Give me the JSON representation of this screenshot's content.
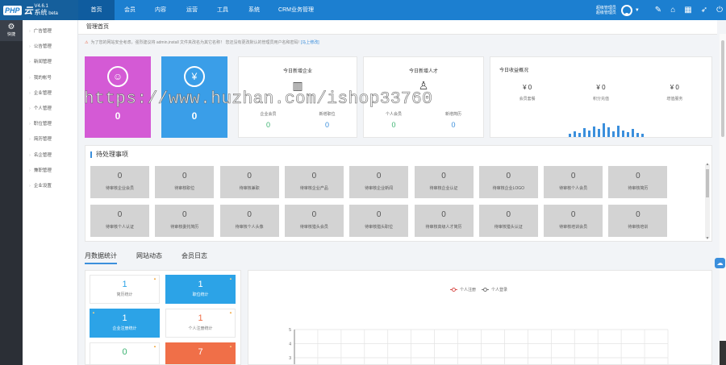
{
  "app": {
    "logo_badge": "PHP",
    "logo_name": "云",
    "version": "V4.6.1",
    "system": "系统",
    "edition": "beta"
  },
  "nav": [
    {
      "label": "首页",
      "active": true
    },
    {
      "label": "会员",
      "active": false
    },
    {
      "label": "内容",
      "active": false
    },
    {
      "label": "运营",
      "active": false
    },
    {
      "label": "工具",
      "active": false
    },
    {
      "label": "系统",
      "active": false
    },
    {
      "label": "CRM业务管理",
      "active": false
    }
  ],
  "user": {
    "line1": "超级管理员",
    "line2": "超级管理员"
  },
  "top_icons": [
    "broom-icon",
    "home-icon",
    "grid-icon",
    "pin-icon",
    "power-icon"
  ],
  "rail": {
    "label": "快捷",
    "icon": "gear-icon"
  },
  "sidebar": [
    "广告管理",
    "公告管理",
    "新闻管理",
    "我的帐号",
    "企业管理",
    "个人管理",
    "职位管理",
    "简历管理",
    "名企管理",
    "兼职管理",
    "企业设置"
  ],
  "breadcrumb": "管理首页",
  "notice": {
    "text": "为了您的网站安全考虑，强烈建议将 admin,install 文件夹改名为其它名称！ 您还没有更改默认的管理员用户名和密码!",
    "link": "[马上修改]"
  },
  "tiles": [
    {
      "value": "0",
      "color": "#d45ad5",
      "icon": "user-icon"
    },
    {
      "value": "0",
      "color": "#3a9ee8",
      "icon": "money-bag-icon"
    }
  ],
  "new_companies": {
    "title": "今日新增企业",
    "icon": "building-icon",
    "items": [
      {
        "label": "企业会员",
        "value": "0"
      },
      {
        "label": "新增职位",
        "value": "0"
      }
    ]
  },
  "new_talents": {
    "title": "今日新增人才",
    "icon": "person-icon",
    "items": [
      {
        "label": "个人会员",
        "value": "0"
      },
      {
        "label": "新增简历",
        "value": "0"
      }
    ]
  },
  "revenue": {
    "title": "今日收益概况",
    "items": [
      {
        "amount": "¥ 0",
        "label": "会员套餐"
      },
      {
        "amount": "¥ 0",
        "label": "积分充值"
      },
      {
        "amount": "¥ 0",
        "label": "增值服务"
      }
    ],
    "sparkline": [
      4,
      7,
      5,
      10,
      8,
      12,
      9,
      16,
      11,
      7,
      13,
      8,
      6,
      9,
      5,
      4
    ]
  },
  "pending": {
    "title": "待处理事项",
    "row1": [
      {
        "n": "0",
        "label": "待审核企业会员"
      },
      {
        "n": "0",
        "label": "待审核职位"
      },
      {
        "n": "0",
        "label": "待审核兼职"
      },
      {
        "n": "0",
        "label": "待审核企业产品"
      },
      {
        "n": "0",
        "label": "待审核企业新闻"
      },
      {
        "n": "0",
        "label": "待审核企业认证"
      },
      {
        "n": "0",
        "label": "待审核企业LOGO"
      },
      {
        "n": "0",
        "label": "待审核个人会员"
      },
      {
        "n": "0",
        "label": "待审核简历"
      }
    ],
    "row2": [
      {
        "n": "0",
        "label": "待审核个人认证"
      },
      {
        "n": "0",
        "label": "待审核委托简历"
      },
      {
        "n": "0",
        "label": "待审核个人头像"
      },
      {
        "n": "0",
        "label": "待审核猎头会员"
      },
      {
        "n": "0",
        "label": "待审核猎头职位"
      },
      {
        "n": "0",
        "label": "待审核高级人才简历"
      },
      {
        "n": "0",
        "label": "待审核猎头认证"
      },
      {
        "n": "0",
        "label": "待审核培训会员"
      },
      {
        "n": "0",
        "label": "待审核培训"
      }
    ]
  },
  "tabs": [
    {
      "label": "月数据统计",
      "active": true
    },
    {
      "label": "网站动态",
      "active": false
    },
    {
      "label": "会员日志",
      "active": false
    }
  ],
  "stat_boxes": [
    {
      "n": "1",
      "label": "简历统计",
      "style": "white",
      "color": "#2ca3e7"
    },
    {
      "n": "1",
      "label": "职位统计",
      "style": "blue",
      "color": "#ffffff"
    },
    {
      "n": "1",
      "label": "企业注册统计",
      "style": "blue",
      "color": "#ffffff"
    },
    {
      "n": "1",
      "label": "个人注册统计",
      "style": "white",
      "color": "#f06f48"
    },
    {
      "n": "0",
      "label": "",
      "style": "white",
      "color": "#3cb371"
    },
    {
      "n": "7",
      "label": "",
      "style": "orange",
      "color": "#ffffff"
    }
  ],
  "chart_data": {
    "type": "line",
    "series": [
      {
        "name": "个人注册",
        "color": "#d9534f",
        "values": []
      },
      {
        "name": "个人登录",
        "color": "#777777",
        "values": []
      }
    ],
    "yticks": [
      "5",
      "4",
      "3",
      "2"
    ],
    "ylim": [
      2,
      5
    ],
    "grid": true,
    "legend": "top-center"
  },
  "watermark": "https://www.huzhan.com/ishop33760"
}
